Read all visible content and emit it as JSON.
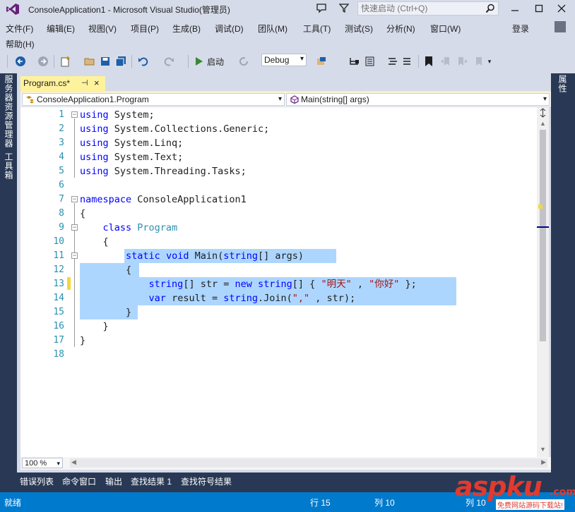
{
  "window": {
    "title": "ConsoleApplication1 - Microsoft Visual Studio(管理员)",
    "quick_launch_placeholder": "快速启动 (Ctrl+Q)"
  },
  "menu": {
    "items": [
      "文件(F)",
      "编辑(E)",
      "视图(V)",
      "项目(P)",
      "生成(B)",
      "调试(D)",
      "团队(M)",
      "工具(T)",
      "测试(S)",
      "分析(N)",
      "窗口(W)",
      "帮助(H)"
    ],
    "login": "登录"
  },
  "toolbar": {
    "start_label": "启动",
    "config": "Debug"
  },
  "side_tabs": {
    "left": [
      "服务器资源管理器",
      "工具箱"
    ],
    "right": [
      "属性"
    ]
  },
  "document": {
    "tab_label": "Program.cs*",
    "pin": "⊣",
    "close": "×",
    "nav_class": "ConsoleApplication1.Program",
    "nav_member": "Main(string[] args)"
  },
  "code": {
    "line_numbers": [
      "1",
      "2",
      "3",
      "4",
      "5",
      "6",
      "7",
      "8",
      "9",
      "10",
      "11",
      "12",
      "13",
      "14",
      "15",
      "16",
      "17",
      "18"
    ],
    "lines": [
      [
        [
          "kw",
          "using"
        ],
        [
          "",
          "System;"
        ]
      ],
      [
        [
          "kw",
          "using"
        ],
        [
          "",
          "System.Collections.Generic;"
        ]
      ],
      [
        [
          "kw",
          "using"
        ],
        [
          "",
          "System.Linq;"
        ]
      ],
      [
        [
          "kw",
          "using"
        ],
        [
          "",
          "System.Text;"
        ]
      ],
      [
        [
          "kw",
          "using"
        ],
        [
          "",
          "System.Threading.Tasks;"
        ]
      ],
      [],
      [
        [
          "kw",
          "namespace"
        ],
        [
          "",
          "ConsoleApplication1"
        ]
      ],
      [
        [
          "",
          "{"
        ]
      ],
      [
        [
          "",
          "    "
        ],
        [
          "kw",
          "class"
        ],
        [
          "",
          ""
        ],
        [
          "ty",
          "Program"
        ]
      ],
      [
        [
          "",
          "    {"
        ]
      ],
      [
        [
          "",
          "        "
        ],
        [
          "kw",
          "static"
        ],
        [
          "",
          ""
        ],
        [
          "kw",
          "void"
        ],
        [
          "",
          "Main("
        ],
        [
          "kw",
          "string"
        ],
        [
          "",
          "[] args)"
        ]
      ],
      [
        [
          "",
          "        {"
        ]
      ],
      [
        [
          "",
          "            "
        ],
        [
          "kw",
          "string"
        ],
        [
          "",
          "[] str = "
        ],
        [
          "kw",
          "new"
        ],
        [
          "",
          ""
        ],
        [
          "kw",
          "string"
        ],
        [
          "",
          "[] { "
        ],
        [
          "str",
          "\"明天\""
        ],
        [
          "",
          ", "
        ],
        [
          "str",
          "\"你好\""
        ],
        [
          "",
          "};"
        ]
      ],
      [
        [
          "",
          "            "
        ],
        [
          "kw",
          "var"
        ],
        [
          "",
          "result = "
        ],
        [
          "kw",
          "string"
        ],
        [
          "",
          ".Join("
        ],
        [
          "str",
          "\",\""
        ],
        [
          "",
          ", str);"
        ]
      ],
      [
        [
          "",
          "        }"
        ]
      ],
      [
        [
          "",
          "    }"
        ]
      ],
      [
        [
          "",
          "}"
        ]
      ],
      []
    ]
  },
  "zoom": "100 %",
  "bottom_tabs": [
    "错误列表",
    "命令窗口",
    "输出",
    "查找结果 1",
    "查找符号结果"
  ],
  "status": {
    "state": "就绪",
    "line": "行 15",
    "col": "列 10",
    "ch": "列 10"
  },
  "watermark": {
    "logo": "aspku",
    "domain": ".com",
    "tagline": "免费网站源码下载站!"
  },
  "colors": {
    "accent": "#007acc",
    "selection": "#add6ff",
    "tab_active": "#fff29d",
    "keyword": "#0000ff",
    "type": "#2b91af",
    "string": "#a31515"
  }
}
